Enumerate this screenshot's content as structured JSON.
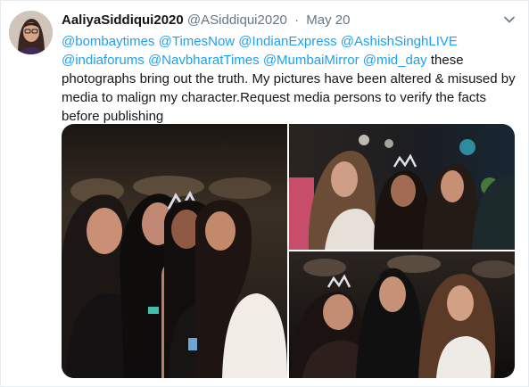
{
  "tweet": {
    "display_name": "AaliyaSiddiqui2020",
    "handle": "@ASiddiqui2020",
    "separator": "·",
    "timestamp": "May 20",
    "more_icon": "chevron-down-icon",
    "mentions_line": [
      "@bombaytimes",
      "@TimesNow",
      "@IndianExpress",
      "@AshishSinghLIVE",
      "@indiaforums",
      "@NavbharatTimes",
      "@MumbaiMirror",
      "@mid_day"
    ],
    "body_text": "these photographs bring out the truth. My pictures have been altered & misused by media to malign my character.Request media persons to verify the facts before publishing"
  },
  "media": {
    "photos": [
      {
        "label": "photo-group-four-women"
      },
      {
        "label": "photo-three-women-tiara"
      },
      {
        "label": "photo-two-women-man"
      }
    ]
  },
  "colors": {
    "mention": "#1da1f2",
    "text": "#14171a",
    "secondary": "#657786",
    "border": "#e6ecf0"
  }
}
